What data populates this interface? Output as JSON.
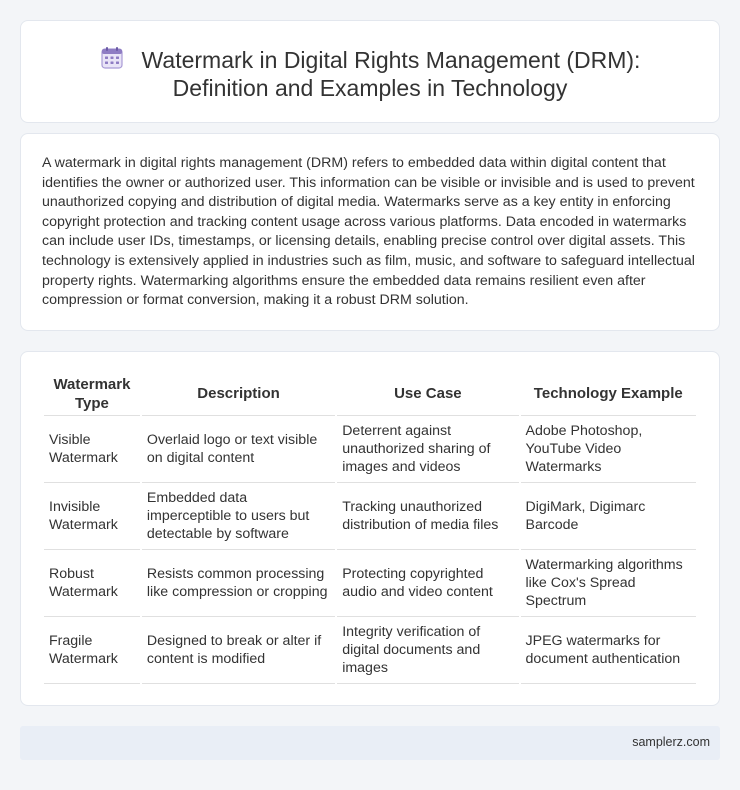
{
  "header": {
    "icon": "calendar-grid-icon",
    "title_line1": "Watermark in Digital Rights Management (DRM):",
    "title_line2": "Definition and Examples in Technology"
  },
  "description": "A watermark in digital rights management (DRM) refers to embedded data within digital content that identifies the owner or authorized user. This information can be visible or invisible and is used to prevent unauthorized copying and distribution of digital media. Watermarks serve as a key entity in enforcing copyright protection and tracking content usage across various platforms. Data encoded in watermarks can include user IDs, timestamps, or licensing details, enabling precise control over digital assets. This technology is extensively applied in industries such as film, music, and software to safeguard intellectual property rights. Watermarking algorithms ensure the embedded data remains resilient even after compression or format conversion, making it a robust DRM solution.",
  "table": {
    "headers": [
      "Watermark Type",
      "Description",
      "Use Case",
      "Technology Example"
    ],
    "rows": [
      [
        "Visible Watermark",
        "Overlaid logo or text visible on digital content",
        "Deterrent against unauthorized sharing of images and videos",
        "Adobe Photoshop, YouTube Video Watermarks"
      ],
      [
        "Invisible Watermark",
        "Embedded data imperceptible to users but detectable by software",
        "Tracking unauthorized distribution of media files",
        "DigiMark, Digimarc Barcode"
      ],
      [
        "Robust Watermark",
        "Resists common processing like compression or cropping",
        "Protecting copyrighted audio and video content",
        "Watermarking algorithms like Cox's Spread Spectrum"
      ],
      [
        "Fragile Watermark",
        "Designed to break or alter if content is modified",
        "Integrity verification of digital documents and images",
        "JPEG watermarks for document authentication"
      ]
    ]
  },
  "footer": {
    "site": "samplerz.com"
  },
  "colors": {
    "page_bg": "#f3f5f8",
    "card_bg": "#ffffff",
    "footer_bg": "#e9eef6",
    "icon_accent": "#8e7cc3"
  }
}
